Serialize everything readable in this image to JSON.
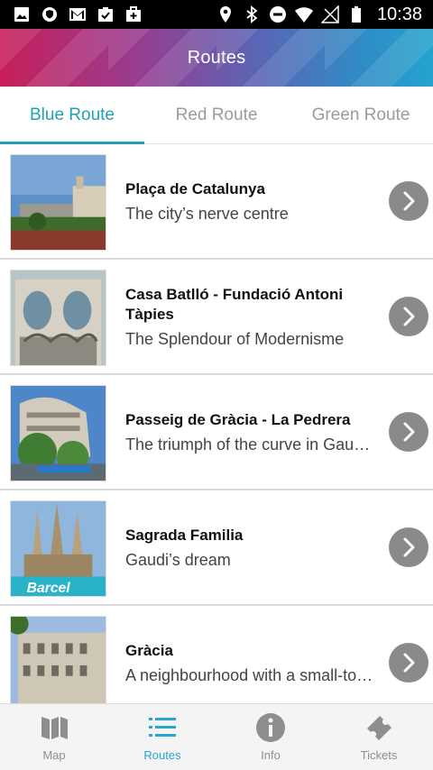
{
  "status_bar": {
    "time": "10:38",
    "left_icons": [
      "image-icon",
      "shield-icon",
      "gmail-icon",
      "clipboard-check-icon",
      "briefcase-plus-icon"
    ],
    "right_icons": [
      "location-pin-icon",
      "bluetooth-icon",
      "do-not-disturb-icon",
      "wifi-icon",
      "signal-off-icon",
      "battery-icon"
    ]
  },
  "app_bar": {
    "title": "Routes"
  },
  "tabs": [
    {
      "label": "Blue Route",
      "active": true
    },
    {
      "label": "Red Route",
      "active": false
    },
    {
      "label": "Green Route",
      "active": false
    }
  ],
  "routes": [
    {
      "title": "Plaça de Catalunya",
      "subtitle": "The city’s nerve centre"
    },
    {
      "title": "Casa Batlló - Fundació Antoni Tàpies",
      "subtitle": "The Splendour of Modernisme"
    },
    {
      "title": "Passeig de Gràcia - La Pedrera",
      "subtitle": "The triumph of the curve in Gaudí’s architecture"
    },
    {
      "title": "Sagrada Familia",
      "subtitle": "Gaudi’s dream",
      "image_text": "Barcel"
    },
    {
      "title": "Gràcia",
      "subtitle": "A neighbourhood with a small-town feel"
    }
  ],
  "bottom_nav": [
    {
      "label": "Map",
      "icon": "map-icon",
      "active": false
    },
    {
      "label": "Routes",
      "icon": "list-icon",
      "active": true
    },
    {
      "label": "Info",
      "icon": "info-icon",
      "active": false
    },
    {
      "label": "Tickets",
      "icon": "ticket-icon",
      "active": false
    }
  ],
  "colors": {
    "accent": "#1fa1b3",
    "nav_active": "#29a5d3",
    "arrow_button": "#8a8a8a"
  }
}
